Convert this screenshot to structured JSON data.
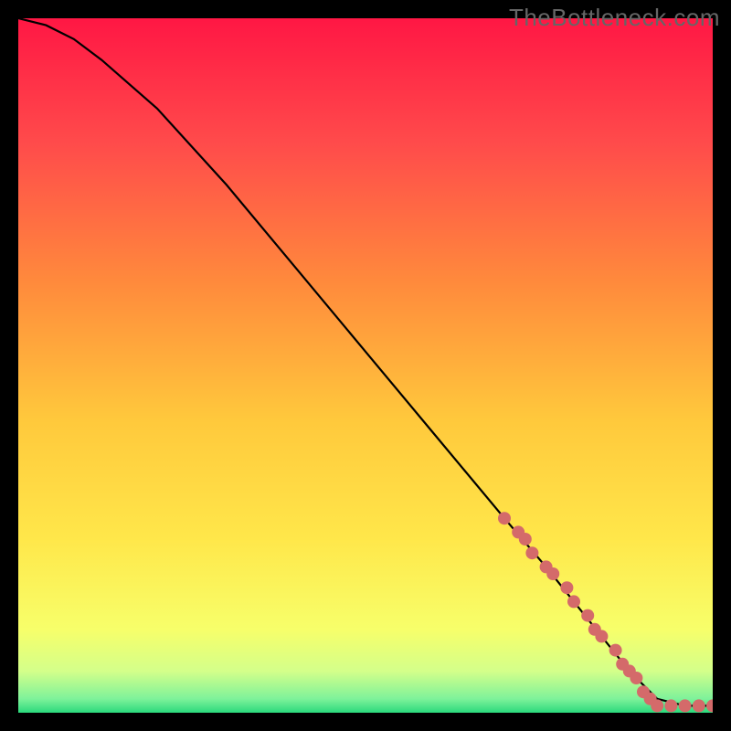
{
  "watermark": "TheBottleneck.com",
  "chart_data": {
    "type": "line",
    "title": "",
    "xlabel": "",
    "ylabel": "",
    "xlim": [
      0,
      100
    ],
    "ylim": [
      0,
      100
    ],
    "grid": false,
    "series": [
      {
        "name": "curve",
        "x": [
          0,
          4,
          8,
          12,
          20,
          30,
          40,
          50,
          60,
          70,
          76,
          80,
          84,
          88,
          92,
          96,
          100
        ],
        "y": [
          100,
          99,
          97,
          94,
          87,
          76,
          64,
          52,
          40,
          28,
          21,
          16,
          11,
          6,
          2,
          1,
          1
        ],
        "stroke": "#000000",
        "markers": false
      },
      {
        "name": "dotted-segment",
        "x": [
          70,
          72,
          73,
          74,
          76,
          77,
          79,
          80,
          82,
          83,
          84,
          86,
          87,
          88,
          89,
          90,
          91,
          92,
          94,
          96,
          98,
          100
        ],
        "y": [
          28,
          26,
          25,
          23,
          21,
          20,
          18,
          16,
          14,
          12,
          11,
          9,
          7,
          6,
          5,
          3,
          2,
          1,
          1,
          1,
          1,
          1
        ],
        "stroke": "#d46a6a",
        "markers": true
      }
    ],
    "gradient_stops": [
      {
        "offset": 0.0,
        "color": "#ff1744"
      },
      {
        "offset": 0.18,
        "color": "#ff4b4b"
      },
      {
        "offset": 0.38,
        "color": "#ff8a3c"
      },
      {
        "offset": 0.58,
        "color": "#ffc93c"
      },
      {
        "offset": 0.75,
        "color": "#ffe74a"
      },
      {
        "offset": 0.88,
        "color": "#f7ff6a"
      },
      {
        "offset": 0.94,
        "color": "#d4ff8a"
      },
      {
        "offset": 0.98,
        "color": "#7ef29a"
      },
      {
        "offset": 1.0,
        "color": "#2bd97c"
      }
    ]
  }
}
